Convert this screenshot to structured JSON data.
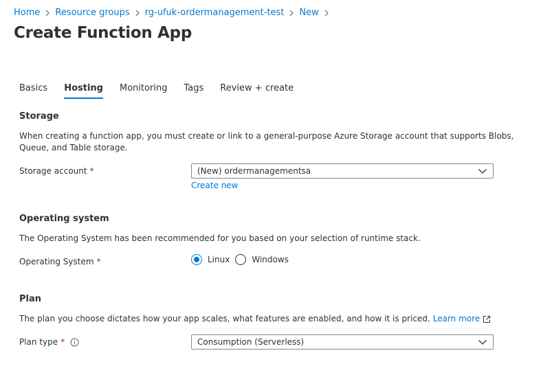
{
  "breadcrumb": {
    "items": [
      "Home",
      "Resource groups",
      "rg-ufuk-ordermanagement-test",
      "New"
    ]
  },
  "title": "Create Function App",
  "tabs": [
    "Basics",
    "Hosting",
    "Monitoring",
    "Tags",
    "Review + create"
  ],
  "active_tab": "Hosting",
  "storage": {
    "heading": "Storage",
    "description": "When creating a function app, you must create or link to a general-purpose Azure Storage account that supports Blobs, Queue, and Table storage.",
    "label": "Storage account",
    "required_mark": "*",
    "value": "(New) ordermanagementsa",
    "create_new": "Create new"
  },
  "os": {
    "heading": "Operating system",
    "description": "The Operating System has been recommended for you based on your selection of runtime stack.",
    "label": "Operating System",
    "required_mark": "*",
    "options": [
      "Linux",
      "Windows"
    ],
    "selected": "Linux"
  },
  "plan": {
    "heading": "Plan",
    "description": "The plan you choose dictates how your app scales, what features are enabled, and how it is priced.",
    "learn_more": "Learn more",
    "label": "Plan type",
    "required_mark": "*",
    "value": "Consumption (Serverless)"
  },
  "colors": {
    "accent": "#0078d4",
    "text": "#323130",
    "required": "#a4262c"
  }
}
